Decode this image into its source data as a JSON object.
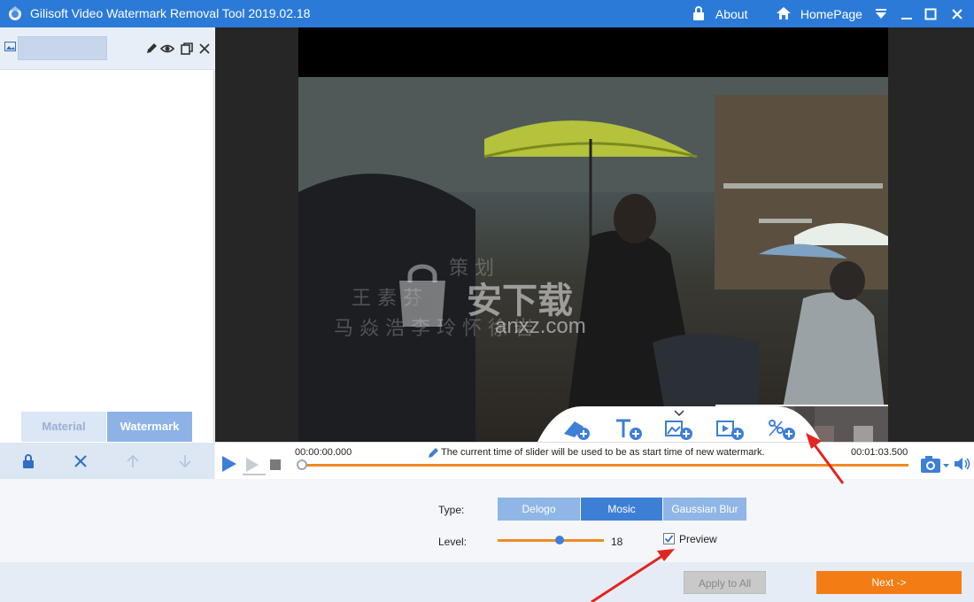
{
  "window": {
    "title": "Gilisoft Video Watermark Removal Tool 2019.02.18",
    "about_label": "About",
    "homepage_label": "HomePage"
  },
  "left_panel": {
    "tabs": [
      {
        "label": "Material",
        "active": false
      },
      {
        "label": "Watermark",
        "active": true
      }
    ]
  },
  "video": {
    "frame_watermark_lines": [
      "策 划",
      "王 素 芬",
      "马 焱 浩   李 玲 怀   徐 岩"
    ],
    "site_watermark": "安下载",
    "site_watermark_sub": "anxz.com"
  },
  "timeline": {
    "start_time": "00:00:00.000",
    "end_time": "00:01:03.500",
    "message": "The current time of slider will be used to be as start time of new watermark.",
    "slider_position": 0
  },
  "settings": {
    "type_label": "Type:",
    "type_options": [
      "Delogo",
      "Mosic",
      "Gaussian Blur"
    ],
    "type_selected": "Mosic",
    "level_label": "Level:",
    "level_value": "18",
    "level_fraction": 0.58,
    "preview_label": "Preview",
    "preview_checked": true
  },
  "actions": {
    "apply_label": "Apply to All",
    "next_label": "Next ->"
  },
  "colors": {
    "titlebar": "#2b7ad8",
    "accent_orange": "#f08a24",
    "selected_blue": "#3e7fd6",
    "option_blue": "#8fb6e6",
    "annotation_red": "#e0261e"
  }
}
